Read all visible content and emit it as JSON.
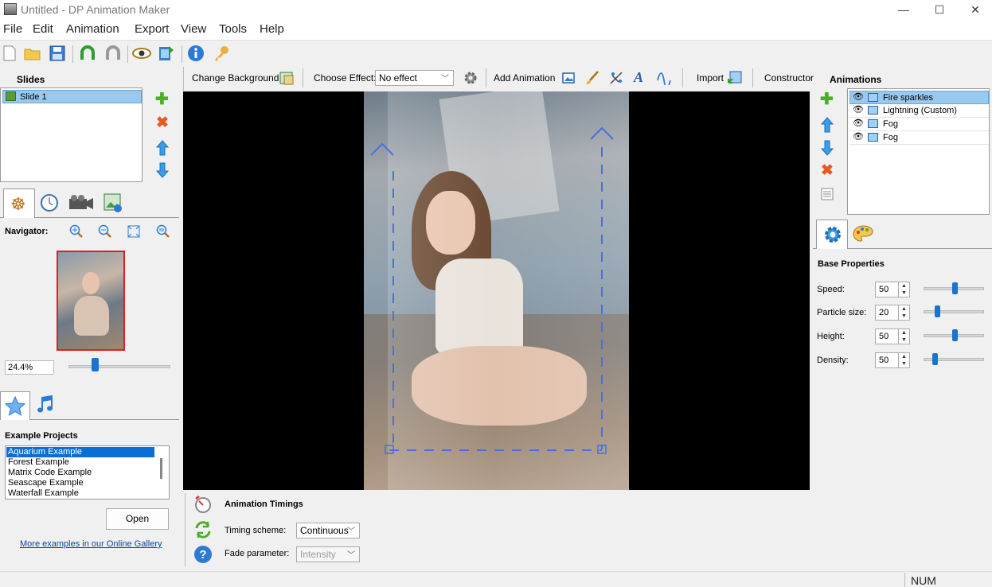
{
  "window": {
    "title": "Untitled - DP Animation Maker",
    "minimize": "—",
    "maximize": "☐",
    "close": "✕"
  },
  "menu": [
    "File",
    "Edit",
    "Animation",
    "Export",
    "View",
    "Tools",
    "Help"
  ],
  "slides": {
    "header": "Slides",
    "items": [
      "Slide 1"
    ]
  },
  "navigator": {
    "label": "Navigator:",
    "zoom_value": "24.4%",
    "zoom_level_fraction": 0.24
  },
  "examples": {
    "header": "Example Projects",
    "items": [
      "Aquarium Example",
      "Forest Example",
      "Matrix Code Example",
      "Seascape Example",
      "Waterfall Example"
    ],
    "open_label": "Open",
    "gallery_link": "More examples in our Online Gallery"
  },
  "effects_bar": {
    "change_background": "Change Background",
    "choose_effect_label": "Choose Effect:",
    "choose_effect_value": "No effect",
    "add_animation": "Add Animation",
    "import": "Import",
    "constructor": "Constructor"
  },
  "timings": {
    "header": "Animation Timings",
    "timing_scheme_label": "Timing scheme:",
    "timing_scheme_value": "Continuous",
    "fade_label": "Fade parameter:",
    "fade_value": "Intensity"
  },
  "animations": {
    "header": "Animations",
    "items": [
      "Fire sparkles",
      "Lightning (Custom)",
      "Fog",
      "Fog"
    ]
  },
  "properties": {
    "header": "Base Properties",
    "rows": [
      {
        "label": "Speed:",
        "value": "50",
        "slider": 0.5
      },
      {
        "label": "Particle size:",
        "value": "20",
        "slider": 0.2
      },
      {
        "label": "Height:",
        "value": "50",
        "slider": 0.5
      },
      {
        "label": "Density:",
        "value": "50",
        "slider": 0.15
      }
    ]
  },
  "statusbar": {
    "num": "NUM"
  },
  "colors": {
    "accent": "#1a73d1",
    "selection": "#99c9ef",
    "canvas": "#000000"
  }
}
